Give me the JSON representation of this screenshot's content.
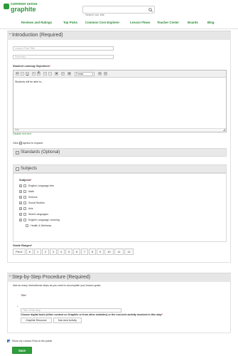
{
  "header": {
    "logo_top": "common sense",
    "logo_bottom": "graphite",
    "search_placeholder": "Search our site"
  },
  "nav": [
    {
      "label": "Reviews and Ratings"
    },
    {
      "label": "Top Picks"
    },
    {
      "label": "Common Core Explorer"
    },
    {
      "label": "Lesson Flows"
    },
    {
      "label": "Teacher Center"
    },
    {
      "label": "Boards"
    },
    {
      "label": "Blog"
    }
  ],
  "intro": {
    "toggle": "−",
    "title": "Introduction (Required)",
    "lesson_title_placeholder": "Lesson Flow Title",
    "summary_placeholder": "Summary",
    "objectives_label": "Student Learning Objectives",
    "required_mark": "*",
    "editor": {
      "format_label": "Format",
      "body_text": "Students will be able to...",
      "status": "body"
    },
    "disable_rich_text": "Disable rich-text",
    "expand_hint_prefix": "Click",
    "expand_hint_suffix": "symbol to expand"
  },
  "standards": {
    "box": "+",
    "title": "Standards (Optional)"
  },
  "subjects": {
    "box": "−",
    "title": "Subjects",
    "label": "Subjects",
    "required_mark": "*",
    "items": [
      {
        "label": "English Language Arts"
      },
      {
        "label": "Math"
      },
      {
        "label": "Science"
      },
      {
        "label": "Social Studies"
      },
      {
        "label": "Arts"
      },
      {
        "label": "World Languages"
      },
      {
        "label": "English Language Learning"
      },
      {
        "label": "Health & Wellness"
      }
    ]
  },
  "grades": {
    "label": "Grade Ranges",
    "required_mark": "*",
    "items": [
      "Pre-K",
      "K",
      "1",
      "2",
      "3",
      "4",
      "5",
      "6",
      "7",
      "8",
      "9",
      "10",
      "11",
      "12"
    ]
  },
  "steps": {
    "toggle": "−",
    "title": "Step-by-Step Procedure (Required)",
    "hint": "Add as many instructional steps as you need to accomplish your lesson goals.",
    "title_label": "Title",
    "required_mark": "*",
    "step_title_placeholder": "Title of this step",
    "tools_prompt": "Choose digital tools (either content on Graphite or from other websites) or the non-tech activity involved in this step",
    "graphite_resource": "Graphite Resource",
    "non_tech": "Non-tech Activity"
  },
  "footer": {
    "publish_label": "Show my Lesson Flow to the public",
    "save_label": "Save"
  },
  "colors": {
    "brand_green": "#2a9a3a",
    "save_green": "#2f9e3c"
  }
}
